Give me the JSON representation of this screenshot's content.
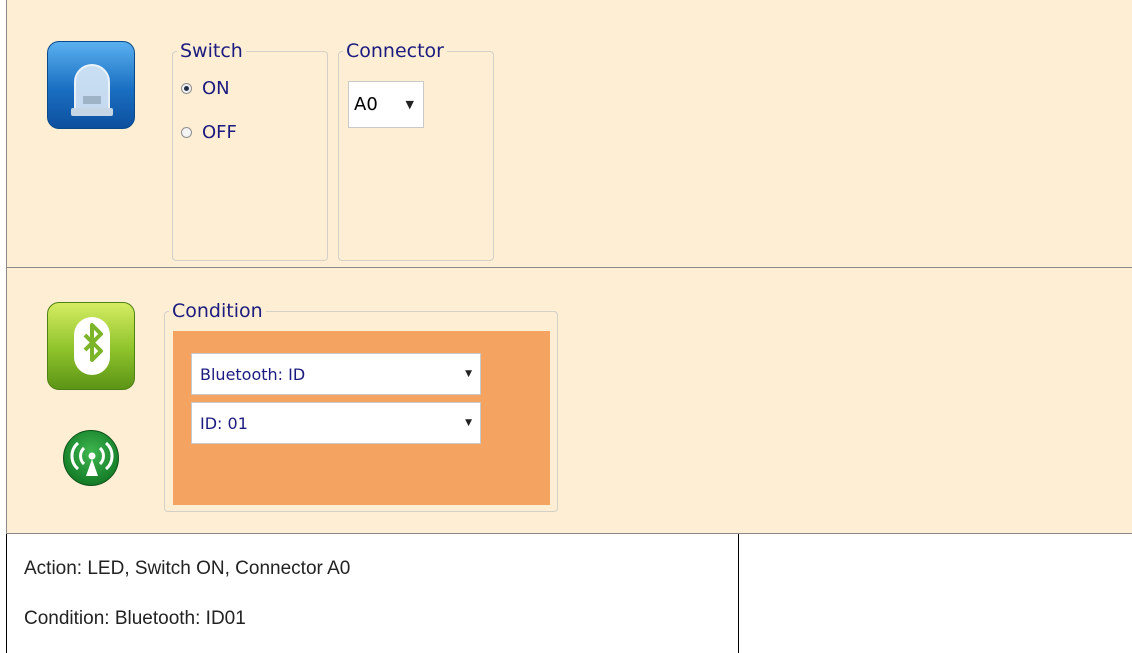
{
  "action_panel": {
    "icon": "led-icon",
    "switch": {
      "legend": "Switch",
      "options": [
        {
          "label": "ON",
          "selected": true
        },
        {
          "label": "OFF",
          "selected": false
        }
      ]
    },
    "connector": {
      "legend": "Connector",
      "selected": "A0"
    }
  },
  "condition_panel": {
    "icons": [
      "bluetooth-icon",
      "wireless-icon"
    ],
    "legend": "Condition",
    "dropdown_type": "Bluetooth: ID",
    "dropdown_id": "ID: 01",
    "colors": {
      "orange_box": "#f4a460"
    }
  },
  "table": {
    "row1": "Action: LED, Switch ON, Connector A0",
    "row2": "Condition: Bluetooth: ID01"
  }
}
